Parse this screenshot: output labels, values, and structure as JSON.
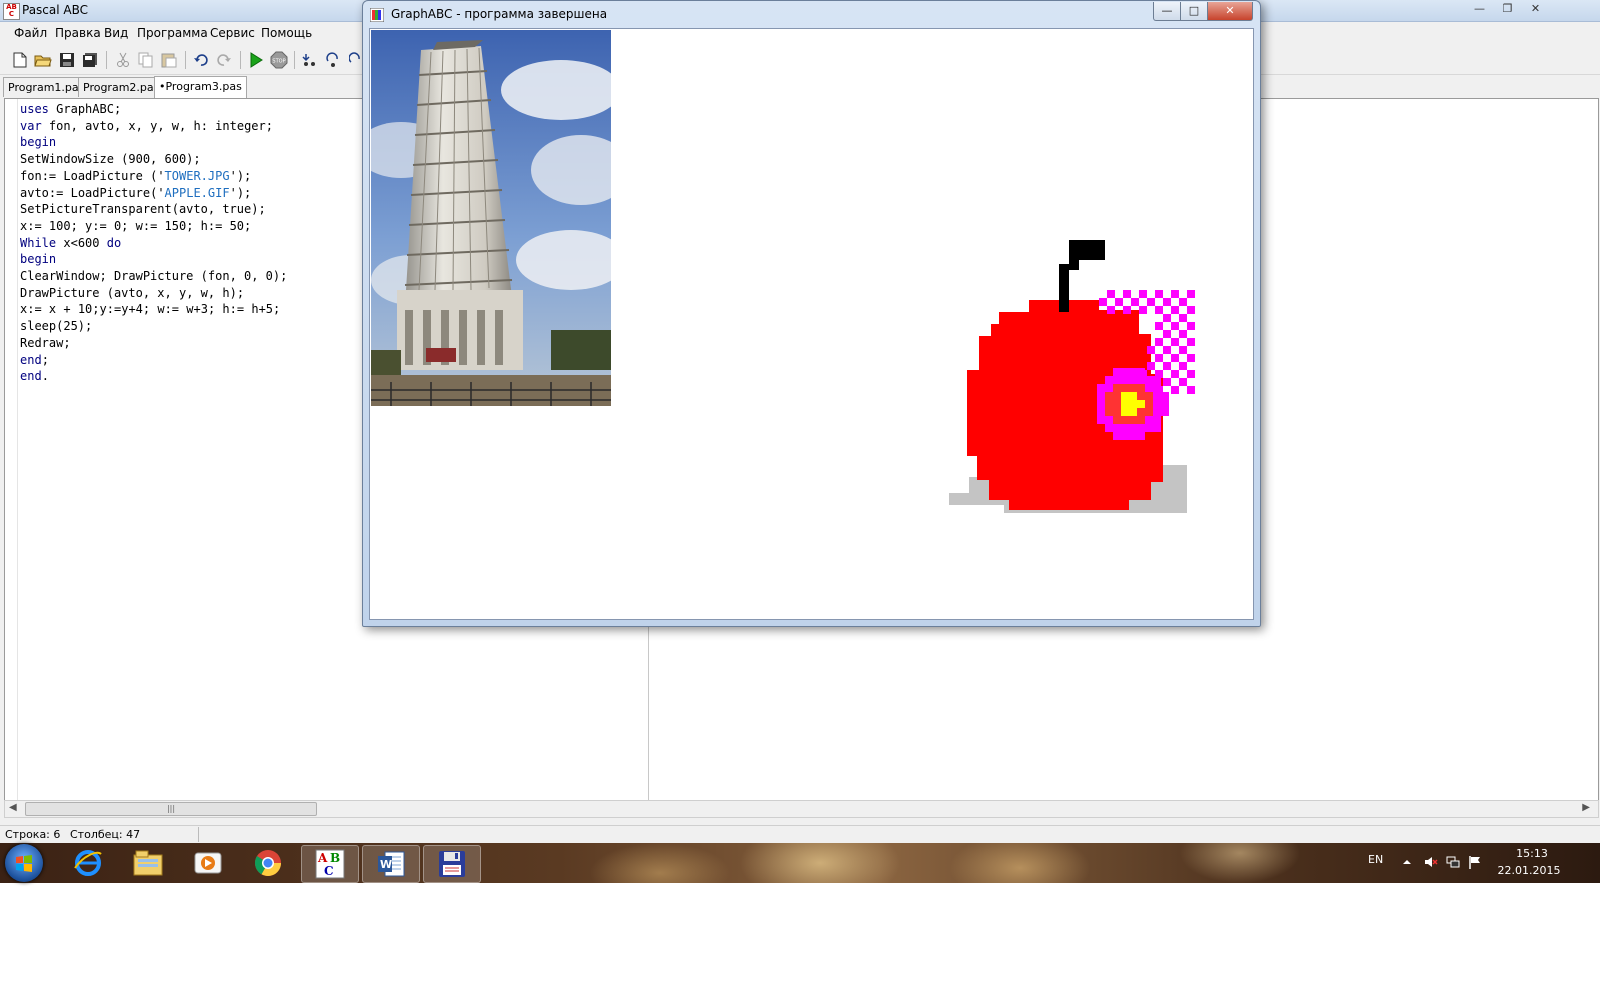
{
  "ide": {
    "title": "Pascal ABC",
    "menu": [
      "Файл",
      "Правка",
      "Вид",
      "Программа",
      "Сервис",
      "Помощь"
    ],
    "tabs": [
      "Program1.pas",
      "Program2.pas",
      "•Program3.pas"
    ],
    "toolbar_icons": [
      "new-file-icon",
      "open-folder-icon",
      "save-icon",
      "save-all-icon",
      "cut-icon",
      "copy-icon",
      "paste-icon",
      "undo-icon",
      "redo-icon",
      "run-icon",
      "stop-icon",
      "step-into-icon",
      "step-over-icon",
      "step-out-icon"
    ],
    "code_lines": [
      "uses GraphABC;",
      "var fon, avto, x, y, w, h: integer;",
      "begin",
      "SetWindowSize (900, 600);",
      "fon:= LoadPicture ('TOWER.JPG');",
      "avto:= LoadPicture('APPLE.GIF');",
      "SetPictureTransparent(avto, true);",
      "x:= 100; y:= 0; w:= 150; h:= 50;",
      "While x<600 do",
      "begin",
      "ClearWindow; DrawPicture (fon, 0, 0);",
      "DrawPicture (avto, x, y, w, h);",
      "x:= x + 10;y:=y+4; w:= w+3; h:= h+5;",
      "sleep(25);",
      "Redraw;",
      "end;",
      "end."
    ],
    "status": {
      "row": "Строка: 6",
      "col": "Столбец: 47"
    }
  },
  "graph_window": {
    "title": "GraphABC - программа завершена"
  },
  "taskbar": {
    "apps": [
      "internet-explorer-icon",
      "file-explorer-icon",
      "media-player-icon",
      "chrome-icon",
      "pascal-abc-icon",
      "word-icon",
      "floppy-save-icon"
    ],
    "lang": "EN",
    "time": "15:13",
    "date": "22.01.2015"
  },
  "colors": {
    "keyword": "#00007f",
    "string": "#1e6ebf",
    "apple_red": "#ff0000",
    "apple_dark": "#800000"
  }
}
